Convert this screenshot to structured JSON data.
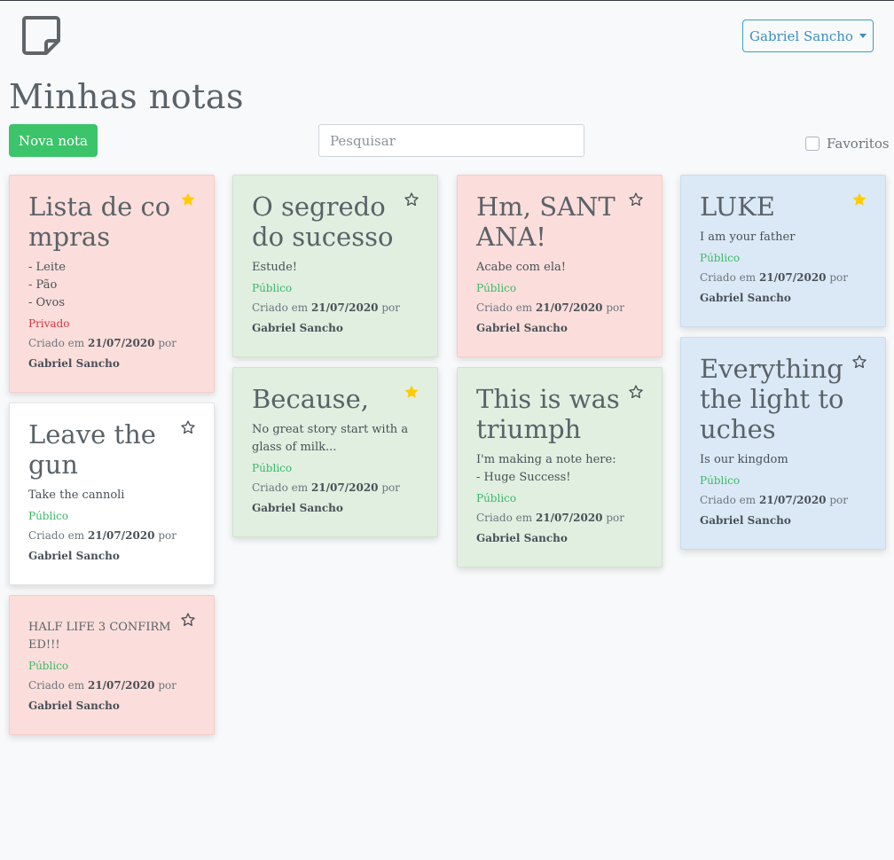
{
  "header": {
    "user_menu": "Gabriel Sancho",
    "logo_icon": "sticky-note-icon"
  },
  "page": {
    "title": "Minhas notas"
  },
  "toolbar": {
    "new_note": "Nova nota",
    "search_placeholder": "Pesquisar",
    "favorites_label": "Favoritos"
  },
  "colors": {
    "red": "#fbdedb",
    "green": "#e0efe0",
    "blue": "#dbe9f6",
    "white": "#ffffff",
    "star": "#ffcc00",
    "accent_green": "#3cc46a"
  },
  "notes": [
    {
      "title": "Lista de compras",
      "body": "- Leite\n- Pão\n- Ovos",
      "visibility": "Privado",
      "date": "21/07/2020",
      "author": "Gabriel Sancho",
      "favorite": true,
      "color": "red"
    },
    {
      "title": "Leave the gun",
      "body": "Take the cannoli",
      "visibility": "Público",
      "date": "21/07/2020",
      "author": "Gabriel Sancho",
      "favorite": false,
      "color": "white"
    },
    {
      "title": "HALF LIFE 3 CONFIRMED!!!",
      "body": "",
      "visibility": "Público",
      "date": "21/07/2020",
      "author": "Gabriel Sancho",
      "favorite": false,
      "color": "red"
    },
    {
      "title": "O segredo do sucesso",
      "body": "Estude!",
      "visibility": "Público",
      "date": "21/07/2020",
      "author": "Gabriel Sancho",
      "favorite": false,
      "color": "green"
    },
    {
      "title": "Because,",
      "body": "No great story start with a glass of milk...",
      "visibility": "Público",
      "date": "21/07/2020",
      "author": "Gabriel Sancho",
      "favorite": true,
      "color": "green"
    },
    {
      "title": "Hm, SANTANA!",
      "body": "Acabe com ela!",
      "visibility": "Público",
      "date": "21/07/2020",
      "author": "Gabriel Sancho",
      "favorite": false,
      "color": "red"
    },
    {
      "title": "This is was triumph",
      "body": "I'm making a note here:\n- Huge Success!",
      "visibility": "Público",
      "date": "21/07/2020",
      "author": "Gabriel Sancho",
      "favorite": false,
      "color": "green"
    },
    {
      "title": "LUKE",
      "body": "I am your father",
      "visibility": "Público",
      "date": "21/07/2020",
      "author": "Gabriel Sancho",
      "favorite": true,
      "color": "blue"
    },
    {
      "title": "Everything the light touches",
      "body": "Is our kingdom",
      "visibility": "Público",
      "date": "21/07/2020",
      "author": "Gabriel Sancho",
      "favorite": false,
      "color": "blue"
    }
  ],
  "labels": {
    "created_prefix": "Criado em",
    "by": "por"
  }
}
